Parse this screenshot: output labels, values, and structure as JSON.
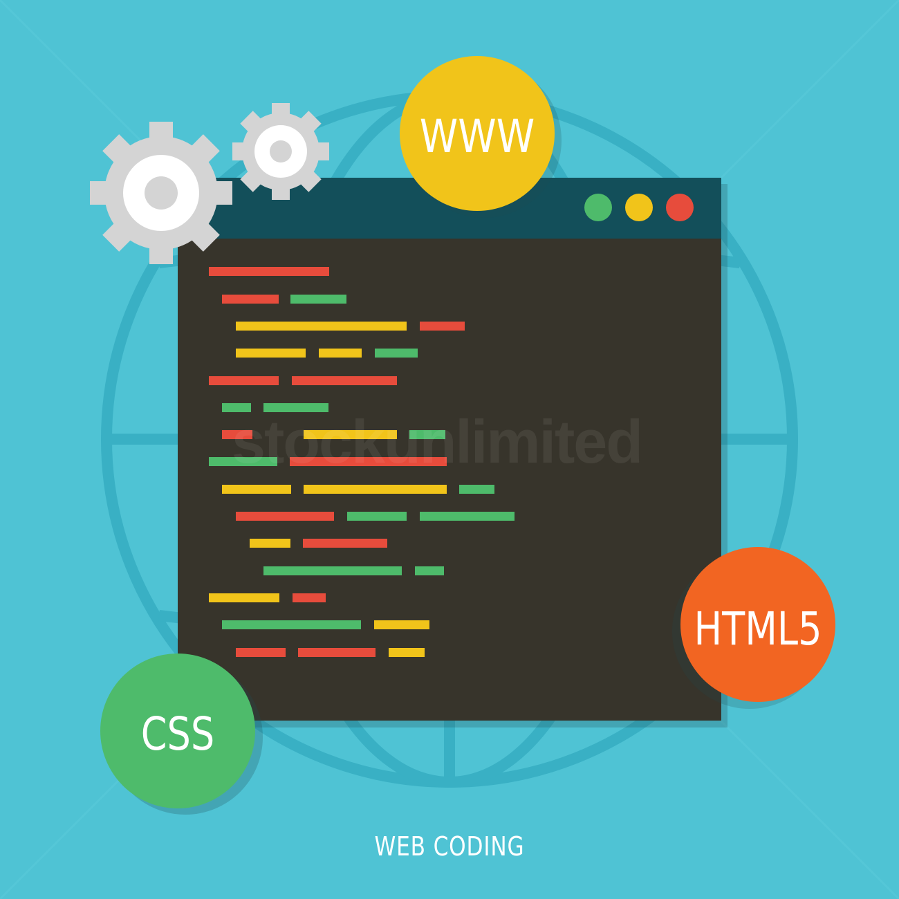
{
  "colors": {
    "background": "#4fc3d4",
    "globe": "#39b0c4",
    "window_titlebar": "#134f5a",
    "window_body": "#37342b",
    "gear": "#d4d4d4",
    "gear_hole": "#ffffff",
    "www_badge": "#f1c41a",
    "html5_badge": "#f26522",
    "css_badge": "#4ebb6b",
    "code_red": "#e74c3c",
    "code_green": "#4ebb6b",
    "code_yellow": "#f1c41a",
    "dot_green": "#4ebb6b",
    "dot_yellow": "#f1c41a",
    "dot_red": "#e74c3c"
  },
  "badges": {
    "www": "WWW",
    "html5": "HTML5",
    "css": "CSS"
  },
  "watermark": "stockunlimited",
  "caption": "WEB CODING",
  "icons": [
    "gear-icon",
    "globe-icon",
    "browser-window-icon"
  ]
}
